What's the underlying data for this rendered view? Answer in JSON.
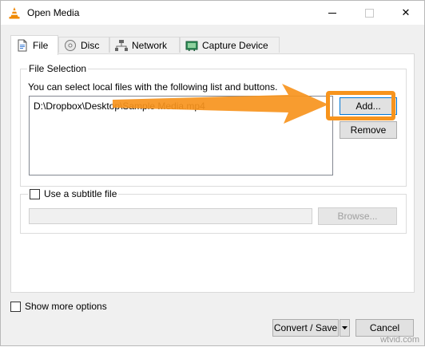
{
  "window": {
    "title": "Open Media",
    "controls": {
      "minimize": "minimize",
      "maximize": "maximize",
      "close": "✕"
    }
  },
  "tabs": [
    {
      "label": "File",
      "icon": "file-icon",
      "active": true
    },
    {
      "label": "Disc",
      "icon": "disc-icon",
      "active": false
    },
    {
      "label": "Network",
      "icon": "network-icon",
      "active": false
    },
    {
      "label": "Capture Device",
      "icon": "capture-device-icon",
      "active": false
    }
  ],
  "file_selection": {
    "legend": "File Selection",
    "hint": "You can select local files with the following list and buttons.",
    "files": [
      "D:\\Dropbox\\Desktop\\Sample Media.mp4"
    ],
    "add_label": "Add...",
    "remove_label": "Remove"
  },
  "subtitle": {
    "checkbox_label": "Use a subtitle file",
    "checked": false,
    "path_value": "",
    "browse_label": "Browse..."
  },
  "footer": {
    "show_more_label": "Show more options",
    "show_more_checked": false,
    "convert_label": "Convert / Save",
    "cancel_label": "Cancel"
  },
  "annotation": {
    "color": "#f7941d",
    "watermark": "wtvid.com"
  },
  "colors": {
    "accent_focus": "#0078d7",
    "vlc_orange": "#f08a00"
  }
}
